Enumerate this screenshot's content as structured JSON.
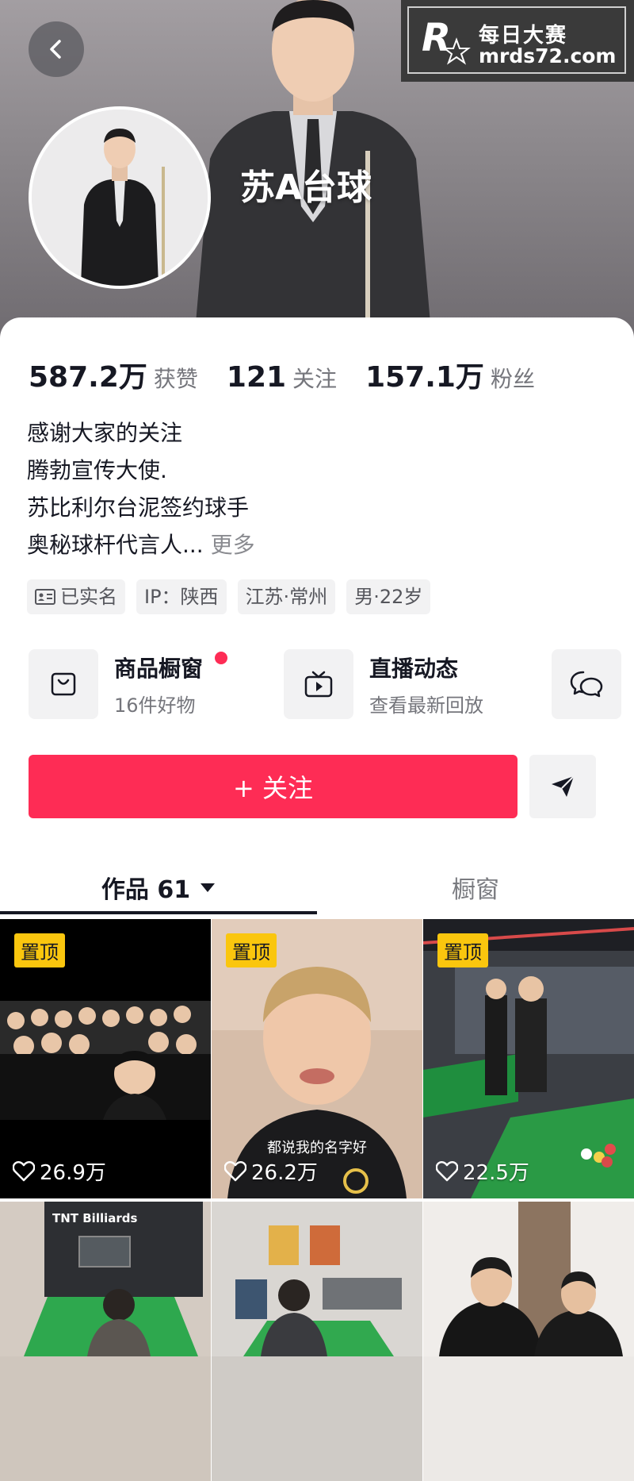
{
  "header": {
    "nickname": "苏A台球",
    "watermark_line1": "每日大赛",
    "watermark_line2": "mrds72.com"
  },
  "stats": [
    {
      "value": "587.2万",
      "label": "获赞"
    },
    {
      "value": "121",
      "label": "关注"
    },
    {
      "value": "157.1万",
      "label": "粉丝"
    }
  ],
  "bio": {
    "lines": [
      "感谢大家的关注",
      "腾勃宣传大使.",
      "苏比利尔台泥签约球手",
      "奥秘球杆代言人..."
    ],
    "more": "更多"
  },
  "tags": [
    {
      "text": "已实名",
      "icon": "id-card-icon"
    },
    {
      "text": "IP：陕西"
    },
    {
      "text": "江苏·常州"
    },
    {
      "text": "男·22岁"
    }
  ],
  "features": {
    "shop": {
      "title": "商品橱窗",
      "subtitle": "16件好物",
      "icon": "shopping-bag-icon"
    },
    "live": {
      "title": "直播动态",
      "subtitle": "查看最新回放",
      "icon": "tv-play-icon"
    },
    "chat_icon": "chat-bubbles-icon"
  },
  "actions": {
    "follow_label": "+ 关注",
    "share_icon": "send-icon"
  },
  "tabs": [
    {
      "label": "作品 61",
      "active": true
    },
    {
      "label": "橱窗",
      "active": false
    }
  ],
  "videos": [
    {
      "pinned": true,
      "pin_label": "置顶",
      "likes": "26.9万"
    },
    {
      "pinned": true,
      "pin_label": "置顶",
      "likes": "26.2万",
      "caption": "都说我的名字好"
    },
    {
      "pinned": true,
      "pin_label": "置顶",
      "likes": "22.5万"
    },
    {
      "pinned": false,
      "sign_text": "TNT Billiards"
    },
    {
      "pinned": false
    },
    {
      "pinned": false
    }
  ],
  "colors": {
    "accent": "#fe2c55",
    "pin_badge": "#fac60e",
    "text_primary": "#161823",
    "text_secondary": "#75767c"
  }
}
